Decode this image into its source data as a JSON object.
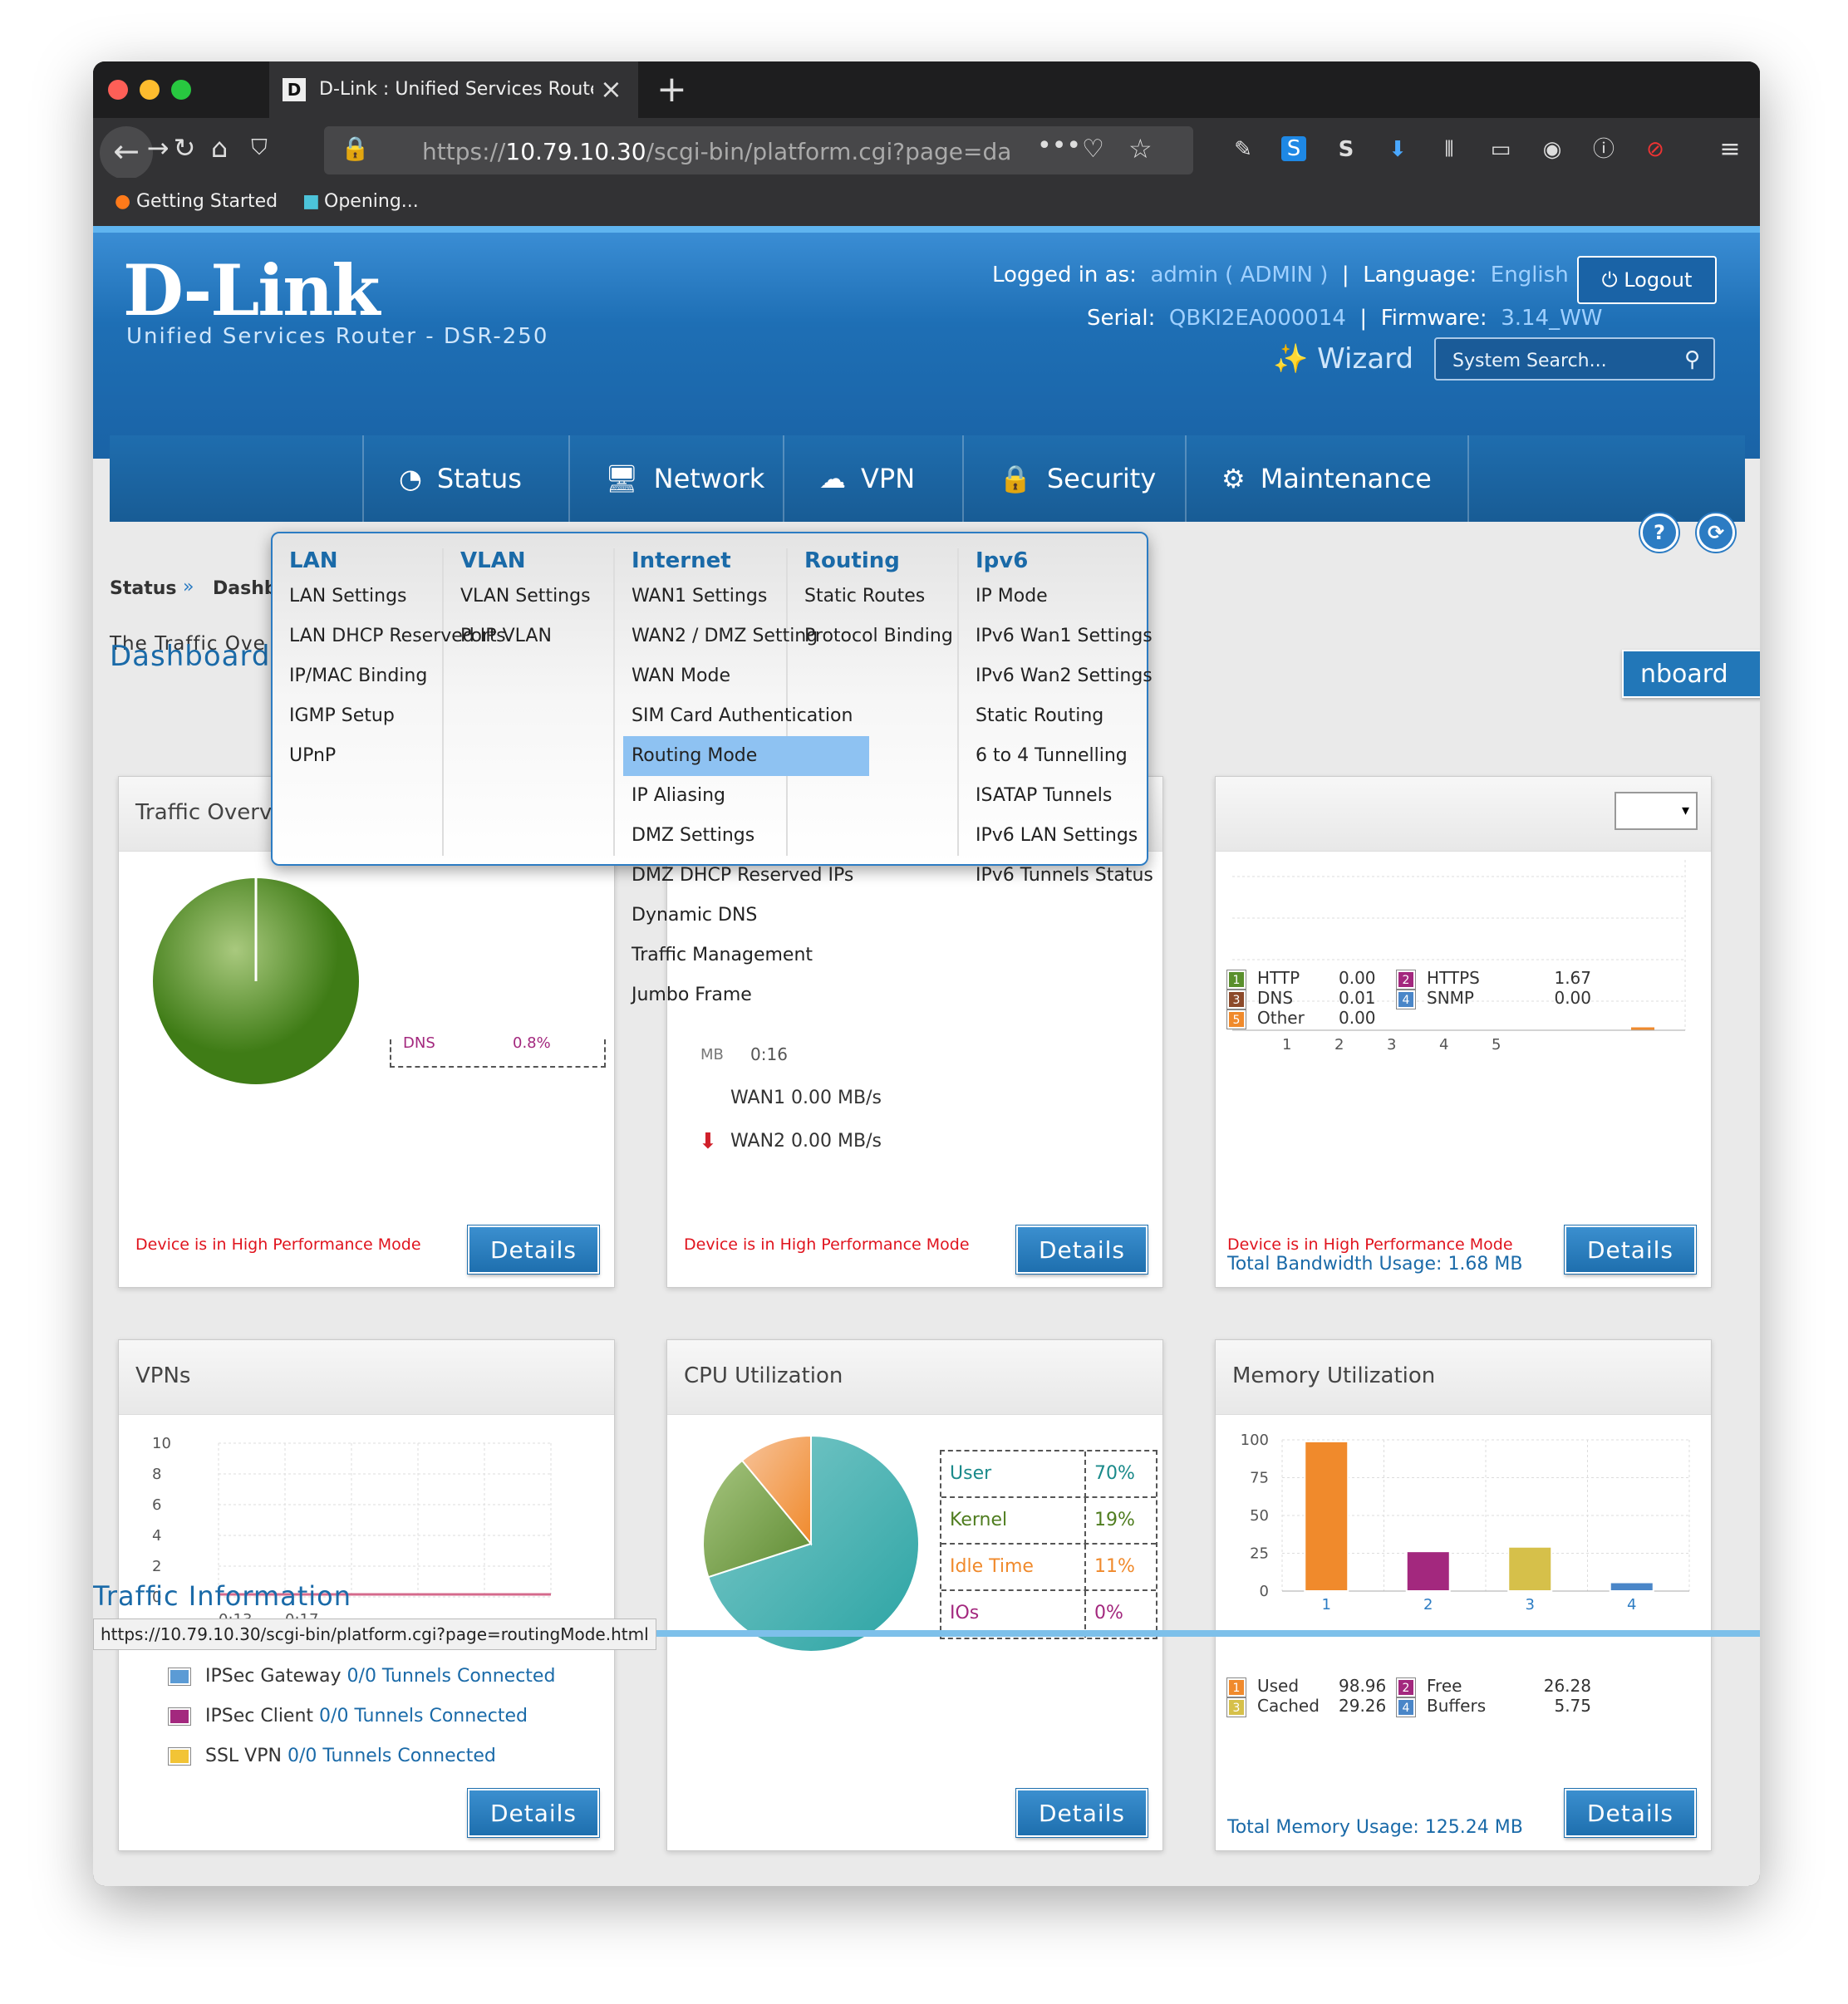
{
  "browser": {
    "tab_title": "D-Link : Unified Services Router",
    "tab_favicon": "D",
    "url_prefix": "https://",
    "url_host": "10.79.10.30",
    "url_path": "/scgi-bin/platform.cgi?page=dashbo",
    "bookmarks": [
      "Getting Started",
      "Opening..."
    ],
    "status_url": "https://10.79.10.30/scgi-bin/platform.cgi?page=routingMode.html"
  },
  "header": {
    "logo": "D-Link",
    "subtitle": "Unified Services Router - DSR-250",
    "logged_label": "Logged in as:",
    "logged_value": "admin ( ADMIN )",
    "language_label": "Language:",
    "language_value": "English [US]",
    "serial_label": "Serial:",
    "serial_value": "QBKI2EA000014",
    "firmware_label": "Firmware:",
    "firmware_value": "3.14_WW",
    "logout": "Logout",
    "wizard": "Wizard",
    "search_placeholder": "System Search..."
  },
  "menu": [
    "Status",
    "Network",
    "VPN",
    "Security",
    "Maintenance"
  ],
  "breadcrumb": {
    "status": "Status",
    "sep": "»",
    "page": "Dashb"
  },
  "intro_text": "The Traffic Ove",
  "page_title": "Dashboard",
  "dash_button": "nboard",
  "dropdown": {
    "columns": [
      {
        "title": "LAN",
        "items": [
          "LAN Settings",
          "LAN DHCP Reserved IPs",
          "IP/MAC Binding",
          "IGMP Setup",
          "UPnP"
        ]
      },
      {
        "title": "VLAN",
        "items": [
          "VLAN Settings",
          "Port VLAN"
        ]
      },
      {
        "title": "Internet",
        "items": [
          "WAN1 Settings",
          "WAN2 / DMZ Setting",
          "WAN Mode",
          "SIM Card Authentication",
          "Routing Mode",
          "IP Aliasing",
          "DMZ Settings",
          "DMZ DHCP Reserved IPs",
          "Dynamic DNS",
          "Traffic Management",
          "Jumbo Frame"
        ]
      },
      {
        "title": "Routing",
        "items": [
          "Static Routes",
          "Protocol Binding"
        ]
      },
      {
        "title": "Ipv6",
        "items": [
          "IP Mode",
          "IPv6 Wan1 Settings",
          "IPv6 Wan2 Settings",
          "Static Routing",
          "6 to 4 Tunnelling",
          "ISATAP Tunnels",
          "IPv6 LAN Settings",
          "IPv6 Tunnels Status"
        ]
      }
    ],
    "selected": "Routing Mode"
  },
  "panels": {
    "traffic": {
      "title": "Traffic Overv",
      "dns_label": "DNS",
      "dns_value": "0.8%",
      "note": "Device is in High Performance Mode",
      "details": "Details"
    },
    "wan": {
      "time_unit": "MB",
      "time": "0:16",
      "wan1": "WAN1 0.00 MB/s",
      "wan2": "WAN2 0.00 MB/s",
      "note": "Device is in High Performance Mode",
      "details": "Details"
    },
    "bandwidth": {
      "legend": [
        {
          "n": "1",
          "label": "HTTP",
          "value": "0.00",
          "color": "#5a8f2c"
        },
        {
          "n": "2",
          "label": "HTTPS",
          "value": "1.67",
          "color": "#a3287e"
        },
        {
          "n": "3",
          "label": "DNS",
          "value": "0.01",
          "color": "#8c4a2b"
        },
        {
          "n": "4",
          "label": "SNMP",
          "value": "0.00",
          "color": "#4a86c8"
        },
        {
          "n": "5",
          "label": "Other",
          "value": "0.00",
          "color": "#f08a2c"
        }
      ],
      "axis": [
        "1",
        "2",
        "3",
        "4",
        "5"
      ],
      "note": "Device is in High Performance Mode",
      "total": "Total Bandwidth Usage: 1.68 MB",
      "details": "Details"
    },
    "vpns": {
      "title": "VPNs",
      "y_ticks": [
        "10",
        "8",
        "6",
        "4",
        "2",
        "0"
      ],
      "x_ticks": [
        "0:13",
        "0:17"
      ],
      "legend": [
        {
          "label": "IPSec Gateway",
          "value": "0/0 Tunnels Connected",
          "color": "#5b9bd5"
        },
        {
          "label": "IPSec Client",
          "value": "0/0 Tunnels Connected",
          "color": "#a3287e"
        },
        {
          "label": "SSL VPN",
          "value": "0/0 Tunnels Connected",
          "color": "#f2c436"
        }
      ],
      "details": "Details"
    },
    "cpu": {
      "title": "CPU Utilization",
      "rows": [
        {
          "label": "User",
          "value": "70%",
          "color": "#1a8a8a"
        },
        {
          "label": "Kernel",
          "value": "19%",
          "color": "#4f7d1f"
        },
        {
          "label": "Idle Time",
          "value": "11%",
          "color": "#f08a2c"
        },
        {
          "label": "IOs",
          "value": "0%",
          "color": "#a3287e"
        }
      ],
      "details": "Details"
    },
    "memory": {
      "title": "Memory Utilization",
      "y_ticks": [
        "100",
        "75",
        "50",
        "25",
        "0"
      ],
      "x_ticks": [
        "1",
        "2",
        "3",
        "4"
      ],
      "legend": [
        {
          "n": "1",
          "label": "Used",
          "value": "98.96",
          "color": "#f08a2c"
        },
        {
          "n": "2",
          "label": "Free",
          "value": "26.28",
          "color": "#a3287e"
        },
        {
          "n": "3",
          "label": "Cached",
          "value": "29.26",
          "color": "#d6c04a"
        },
        {
          "n": "4",
          "label": "Buffers",
          "value": "5.75",
          "color": "#4a86c8"
        }
      ],
      "total": "Total Memory Usage: 125.24 MB",
      "details": "Details"
    }
  },
  "traffic_info": "Traffic Information",
  "chart_data": [
    {
      "type": "pie",
      "title": "CPU Utilization",
      "categories": [
        "User",
        "Kernel",
        "Idle Time",
        "IOs"
      ],
      "values": [
        70,
        19,
        11,
        0
      ]
    },
    {
      "type": "bar",
      "title": "Memory Utilization",
      "categories": [
        "1",
        "2",
        "3",
        "4"
      ],
      "series": [
        {
          "name": "Memory",
          "values": [
            98.96,
            26.28,
            29.26,
            5.75
          ]
        }
      ],
      "ylim": [
        0,
        100
      ]
    }
  ]
}
